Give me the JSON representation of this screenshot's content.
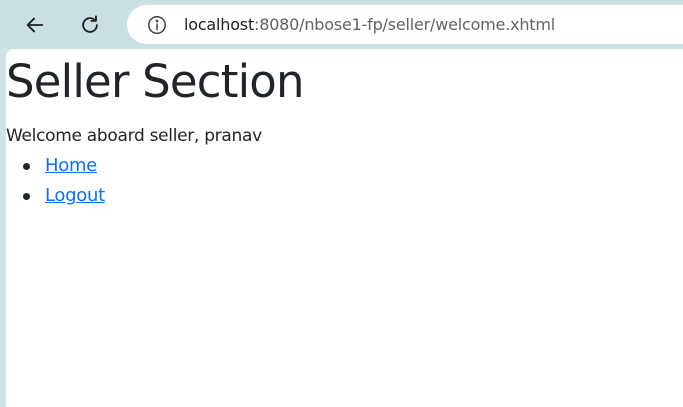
{
  "browser": {
    "url_host": "localhost",
    "url_path": ":8080/nbose1-fp/seller/welcome.xhtml",
    "icons": {
      "back": "arrow-left-icon",
      "reload": "reload-icon",
      "site_info": "info-icon"
    }
  },
  "page": {
    "title": "Seller Section",
    "welcome": "Welcome aboard seller, pranav",
    "nav_links": [
      {
        "label": "Home"
      },
      {
        "label": "Logout"
      }
    ]
  },
  "colors": {
    "link": "#0d6efd",
    "text": "#212529",
    "chrome_bg": "#c9e0e3"
  }
}
